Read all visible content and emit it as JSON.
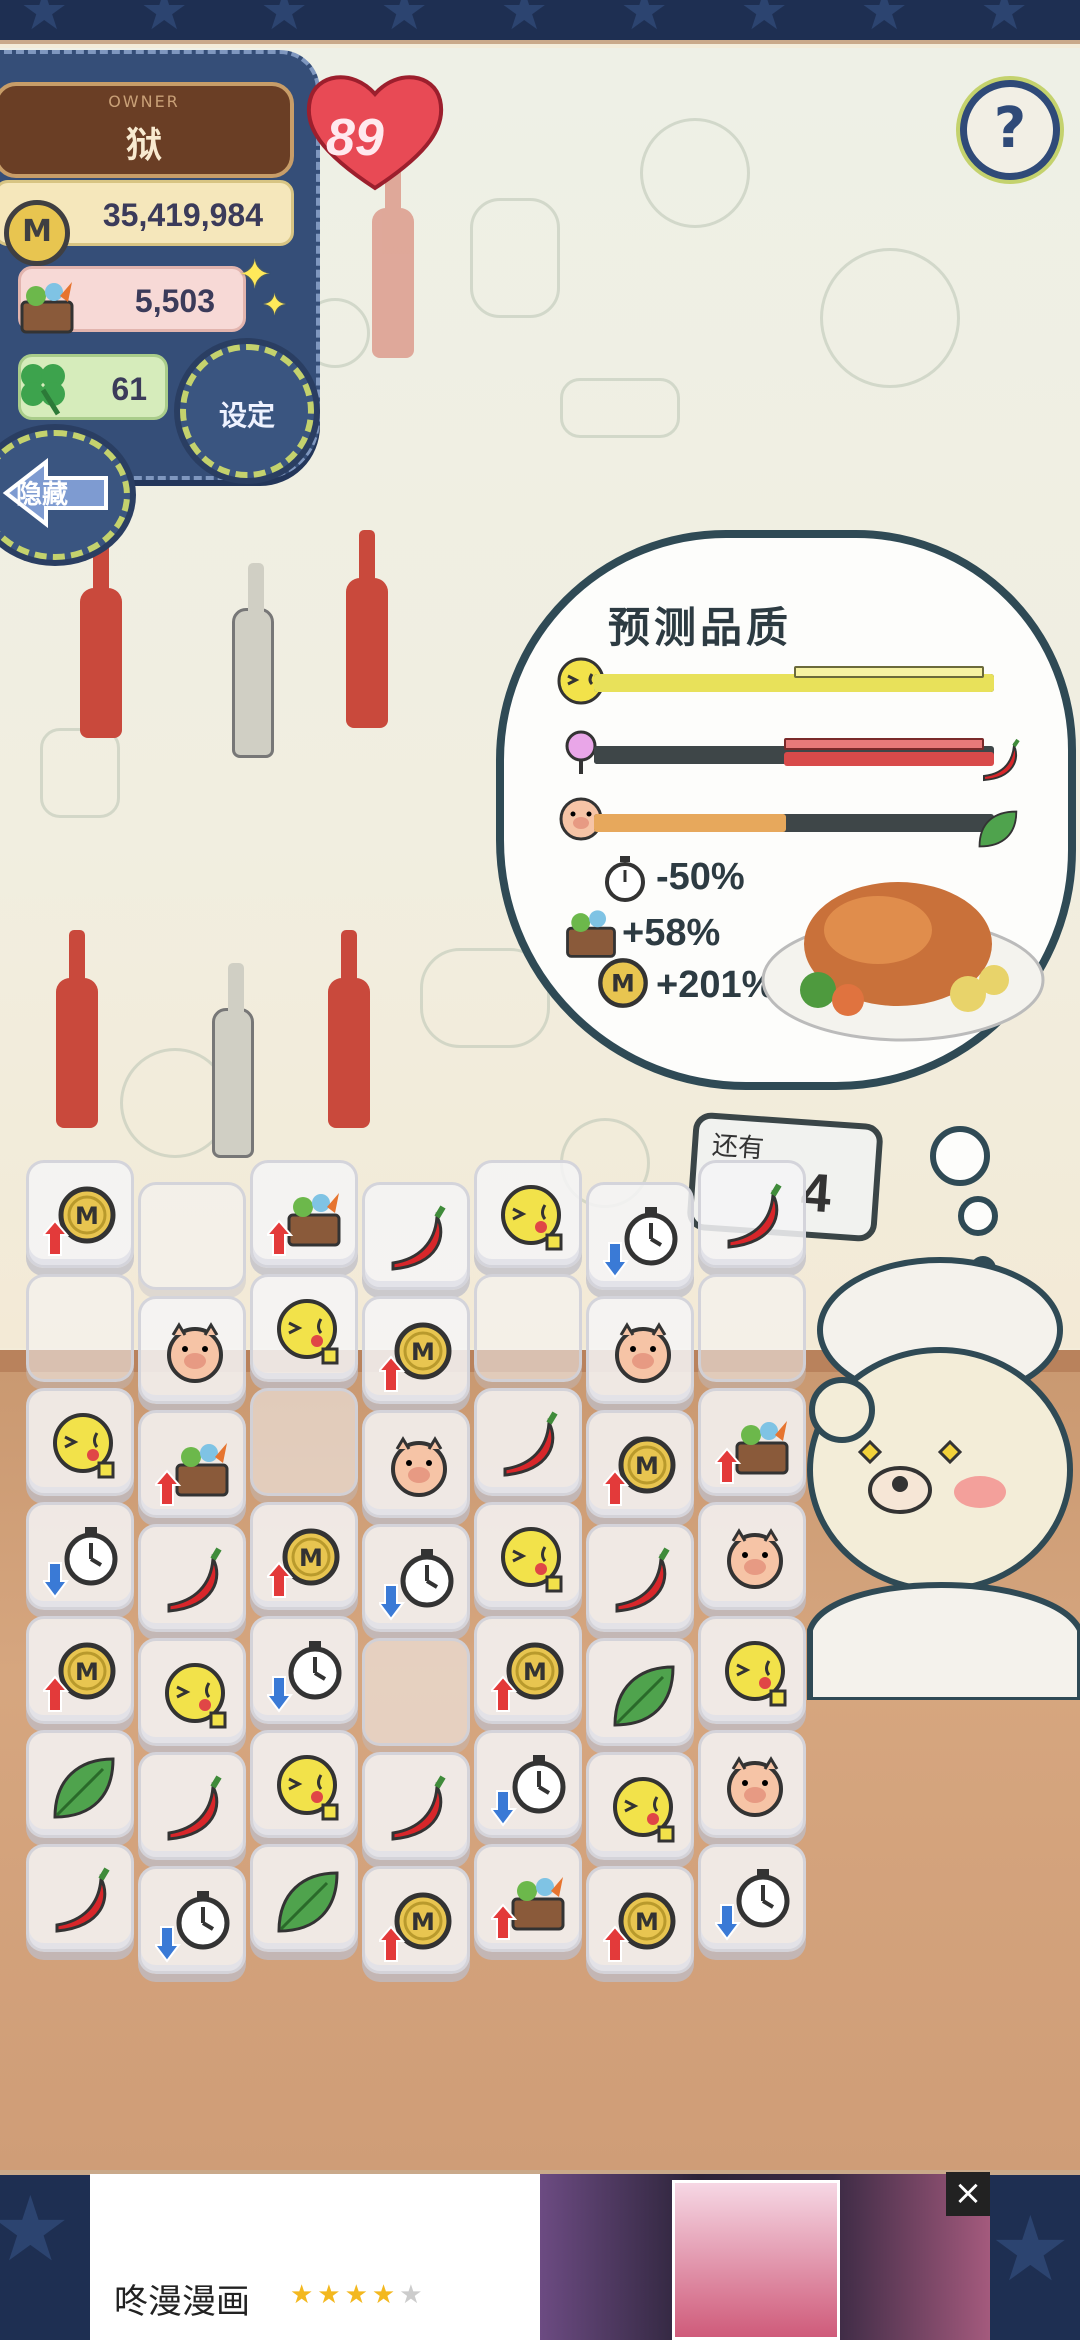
{
  "owner": {
    "tag": "OWNER",
    "name": "狱"
  },
  "level": "89",
  "stats": {
    "money": "35,419,984",
    "ingredients": "5,503",
    "luck": "61"
  },
  "buttons": {
    "settings": "设定",
    "hide": "隐藏",
    "help": "?"
  },
  "prediction": {
    "title": "预测品质",
    "bars": [
      {
        "name": "taste",
        "icon": "smiley-yum-icon",
        "color": "#e8e15a"
      },
      {
        "name": "sweet",
        "icon": "lollipop-icon",
        "color": "#d84a4a"
      },
      {
        "name": "aroma",
        "icon": "pig-icon",
        "color": "#e7a85c"
      }
    ],
    "modifiers": [
      {
        "icon": "stopwatch-icon",
        "value": "-50%"
      },
      {
        "icon": "ingredient-basket-icon",
        "value": "+58%"
      },
      {
        "icon": "coin-icon",
        "value": "+201%"
      }
    ]
  },
  "remaining": {
    "label": "还有",
    "count": "4"
  },
  "board": {
    "rows": [
      [
        "coin-up",
        "empty",
        "basket-up",
        "chili",
        "smiley",
        "watch-down",
        "chili"
      ],
      [
        "empty",
        "pig",
        "smiley",
        "coin-up",
        "empty",
        "pig",
        "empty"
      ],
      [
        "smiley",
        "basket-up",
        "empty",
        "pig",
        "chili",
        "coin-up",
        "basket-up"
      ],
      [
        "watch-down",
        "chili",
        "coin-up",
        "watch-down",
        "smiley",
        "chili",
        "pig"
      ],
      [
        "coin-up",
        "smiley",
        "watch-down",
        "empty",
        "coin-up",
        "leaf",
        "smiley"
      ],
      [
        "leaf",
        "chili",
        "smiley",
        "chili",
        "watch-down",
        "smiley",
        "pig"
      ],
      [
        "chili",
        "watch-down",
        "leaf",
        "coin-up",
        "basket-up",
        "coin-up",
        "watch-down"
      ]
    ]
  },
  "ad": {
    "title": "咚漫漫画",
    "rating": 4,
    "close": "×"
  }
}
